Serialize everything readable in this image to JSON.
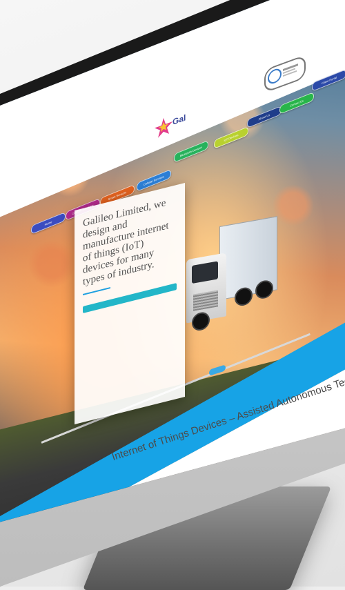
{
  "site": {
    "logo_text": "Gal",
    "certification_seal": ""
  },
  "nav": {
    "items": [
      {
        "label": "Home",
        "color": "#3b4cc0"
      },
      {
        "label": "Custom Solutions",
        "color": "#b42b8e"
      },
      {
        "label": "Smart Sensors",
        "color": "#e2621f"
      },
      {
        "label": "Cellular Services",
        "color": "#2c7fd6"
      },
      {
        "label": "Bluetooth Devices",
        "color": "#27b25c"
      },
      {
        "label": "IoT Devices",
        "color": "#b9d12f"
      },
      {
        "label": "About Us",
        "color": "#1f3d8a"
      },
      {
        "label": "Contact Us",
        "color": "#28b54a"
      },
      {
        "label": "Client Portal",
        "color": "#2c4aa8"
      }
    ]
  },
  "hero": {
    "headline": "Galileo Limited, we design and manufacture internet of things (IoT) devices for many types of industry.",
    "body": "",
    "cta_label": "",
    "slider_indicator": "• • •"
  },
  "section": {
    "subheading": "Internet of Things Devices – Assisted Autonomous Technology"
  },
  "colors": {
    "accent_blue": "#17a3e6",
    "cta_teal": "#23b6c8",
    "bezel": "#1a1a1a"
  }
}
